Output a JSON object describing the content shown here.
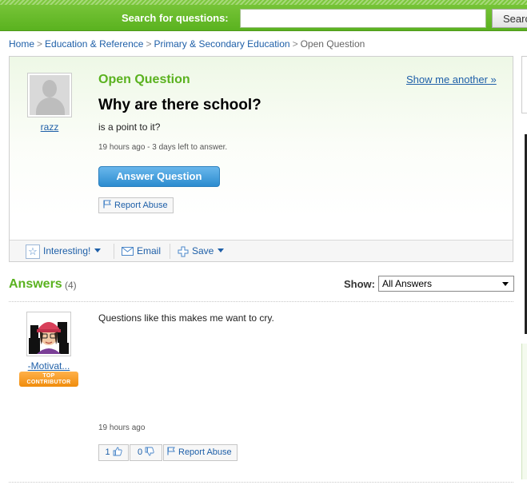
{
  "search": {
    "label": "Search for questions:",
    "placeholder": "",
    "button_label": "Search"
  },
  "breadcrumb": {
    "items": [
      "Home",
      "Education & Reference",
      "Primary & Secondary Education"
    ],
    "current": "Open Question",
    "separator": ">"
  },
  "question": {
    "status": "Open Question",
    "show_another": "Show me another »",
    "asker": "razz",
    "title": "Why are there school?",
    "body": "is a point to it?",
    "meta": "19 hours ago - 3 days left to answer.",
    "answer_button": "Answer Question",
    "report_abuse": "Report Abuse"
  },
  "toolbar": {
    "interesting": "Interesting!",
    "email": "Email",
    "save": "Save"
  },
  "answers": {
    "title": "Answers",
    "count": "(4)",
    "show_label": "Show:",
    "show_selected": "All Answers",
    "items": [
      {
        "author": "-Motivat...",
        "badge_line1": "TOP",
        "badge_line2": "CONTRIBUTOR",
        "text": "Questions like this makes me want to cry.",
        "time": "19 hours ago",
        "thumbs_up": "1",
        "thumbs_down": "0",
        "report_abuse": "Report Abuse"
      }
    ]
  },
  "colors": {
    "brand_green": "#5ab21f",
    "link_blue": "#1e5fa8",
    "button_blue": "#2c8ccf",
    "badge_orange": "#f08c0c"
  },
  "icons": [
    "star-icon",
    "envelope-icon",
    "plus-icon",
    "flag-icon",
    "thumbs-up-icon",
    "thumbs-down-icon",
    "caret-down-icon"
  ]
}
